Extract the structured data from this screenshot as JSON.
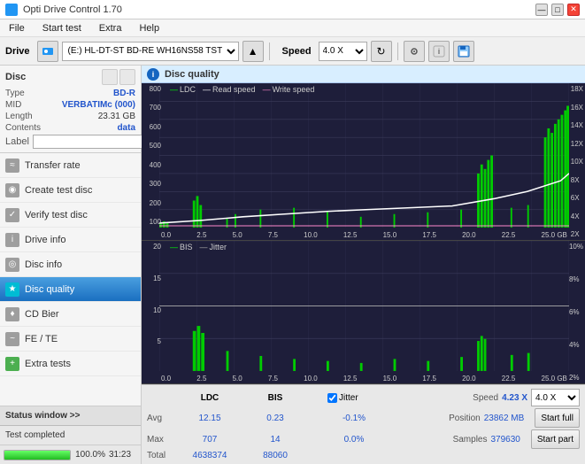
{
  "app": {
    "title": "Opti Drive Control 1.70",
    "icon": "disc-icon"
  },
  "title_controls": {
    "minimize": "—",
    "maximize": "□",
    "close": "✕"
  },
  "menu": {
    "items": [
      "File",
      "Start test",
      "Extra",
      "Help"
    ]
  },
  "toolbar": {
    "drive_label": "Drive",
    "drive_value": "(E:)  HL-DT-ST BD-RE  WH16NS58 TST4",
    "speed_label": "Speed",
    "speed_value": "4.0 X"
  },
  "disc": {
    "title": "Disc",
    "type_label": "Type",
    "type_value": "BD-R",
    "mid_label": "MID",
    "mid_value": "VERBATIMc (000)",
    "length_label": "Length",
    "length_value": "23.31 GB",
    "contents_label": "Contents",
    "contents_value": "data",
    "label_label": "Label",
    "label_placeholder": ""
  },
  "nav": {
    "items": [
      {
        "id": "transfer-rate",
        "label": "Transfer rate",
        "icon": "chart-icon",
        "active": false
      },
      {
        "id": "create-test-disc",
        "label": "Create test disc",
        "icon": "disc-write-icon",
        "active": false
      },
      {
        "id": "verify-test-disc",
        "label": "Verify test disc",
        "icon": "disc-verify-icon",
        "active": false
      },
      {
        "id": "drive-info",
        "label": "Drive info",
        "icon": "info-icon",
        "active": false
      },
      {
        "id": "disc-info",
        "label": "Disc info",
        "icon": "disc-info-icon",
        "active": false
      },
      {
        "id": "disc-quality",
        "label": "Disc quality",
        "icon": "quality-icon",
        "active": true
      },
      {
        "id": "cd-bier",
        "label": "CD Bier",
        "icon": "cd-icon",
        "active": false
      },
      {
        "id": "fe-te",
        "label": "FE / TE",
        "icon": "wave-icon",
        "active": false
      },
      {
        "id": "extra-tests",
        "label": "Extra tests",
        "icon": "extra-icon",
        "active": false
      }
    ]
  },
  "status_window": {
    "label": "Status window >>"
  },
  "status_bar": {
    "text": "Test completed",
    "progress": 100,
    "progress_display": "100.0%",
    "time": "31:23"
  },
  "disc_quality": {
    "title": "Disc quality",
    "chart1": {
      "legend": [
        {
          "id": "ldc",
          "label": "LDC",
          "color": "#00ff00"
        },
        {
          "id": "read-speed",
          "label": "Read speed",
          "color": "#ffffff"
        },
        {
          "id": "write-speed",
          "label": "Write speed",
          "color": "#ff88cc"
        }
      ],
      "y_axis_left": [
        "800",
        "700",
        "600",
        "500",
        "400",
        "300",
        "200",
        "100"
      ],
      "y_axis_right": [
        "18X",
        "16X",
        "14X",
        "12X",
        "10X",
        "8X",
        "6X",
        "4X",
        "2X"
      ],
      "x_axis": [
        "0.0",
        "2.5",
        "5.0",
        "7.5",
        "10.0",
        "12.5",
        "15.0",
        "17.5",
        "20.0",
        "22.5",
        "25.0 GB"
      ]
    },
    "chart2": {
      "legend": [
        {
          "id": "bis",
          "label": "BIS",
          "color": "#00ff00"
        },
        {
          "id": "jitter",
          "label": "Jitter",
          "color": "#dddddd"
        }
      ],
      "y_axis_left": [
        "20",
        "15",
        "10",
        "5"
      ],
      "y_axis_right": [
        "10%",
        "8%",
        "6%",
        "4%",
        "2%"
      ],
      "x_axis": [
        "0.0",
        "2.5",
        "5.0",
        "7.5",
        "10.0",
        "12.5",
        "15.0",
        "17.5",
        "20.0",
        "22.5",
        "25.0 GB"
      ]
    },
    "stats": {
      "headers": [
        "",
        "LDC",
        "BIS",
        "",
        "Jitter",
        "Speed",
        ""
      ],
      "avg_label": "Avg",
      "avg_ldc": "12.15",
      "avg_bis": "0.23",
      "avg_jitter": "-0.1%",
      "max_label": "Max",
      "max_ldc": "707",
      "max_bis": "14",
      "max_jitter": "0.0%",
      "total_label": "Total",
      "total_ldc": "4638374",
      "total_bis": "88060",
      "speed_label": "Speed",
      "speed_value": "4.23 X",
      "speed_select": "4.0 X",
      "position_label": "Position",
      "position_value": "23862 MB",
      "samples_label": "Samples",
      "samples_value": "379630",
      "jitter_checked": true,
      "jitter_label": "Jitter",
      "start_full_label": "Start full",
      "start_part_label": "Start part"
    }
  }
}
